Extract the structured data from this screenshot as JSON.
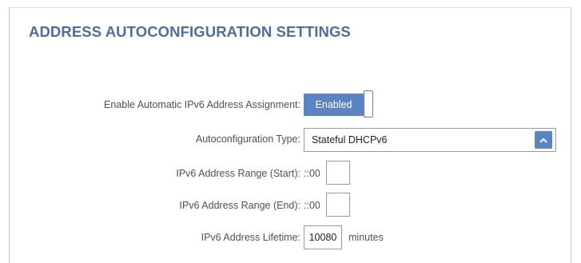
{
  "section": {
    "title": "ADDRESS AUTOCONFIGURATION SETTINGS"
  },
  "fields": {
    "auto_assign": {
      "label": "Enable Automatic IPv6 Address Assignment:",
      "toggle_text": "Enabled"
    },
    "autoconfig_type": {
      "label": "Autoconfiguration Type:",
      "selected": "Stateful DHCPv6"
    },
    "range_start": {
      "label": "IPv6 Address Range (Start):",
      "prefix": "::00",
      "value": ""
    },
    "range_end": {
      "label": "IPv6 Address Range (End):",
      "prefix": "::00",
      "value": ""
    },
    "lifetime": {
      "label": "IPv6 Address Lifetime:",
      "value": "10080",
      "unit": "minutes"
    }
  },
  "colors": {
    "title": "#4a6ea5",
    "accent": "#5b84c4"
  },
  "icons": {
    "select_toggle": "chevron-up-icon"
  }
}
